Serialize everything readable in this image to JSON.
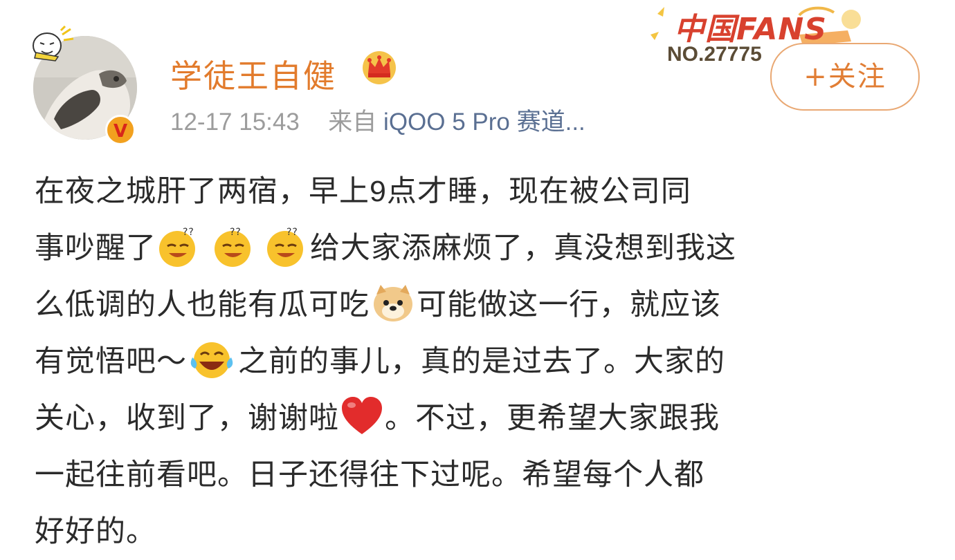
{
  "post": {
    "username": "学徒王自健",
    "timestamp": "12-17 15:43",
    "source_prefix": "来自",
    "source": "iQOO 5 Pro 赛道...",
    "follow_label": "+关注",
    "fans_badge_title": "中国FANS",
    "fans_badge_no": "NO.27775",
    "verified_badge": "V",
    "content": {
      "l1": "在夜之城肝了两宿，早上9点才睡，现在被公司同",
      "l2a": "事吵醒了",
      "l2b": "给大家添麻烦了，真没想到我这",
      "l3a": "么低调的人也能有瓜可吃",
      "l3b": "可能做这一行，就应该",
      "l4a": "有觉悟吧～",
      "l4b": "之前的事儿，真的是过去了。大家的",
      "l5a": "关心，收到了，谢谢啦",
      "l5b": "。不过，更希望大家跟我",
      "l6": "一起往前看吧。日子还得往下过呢。希望每个人都",
      "l7": "好好的。"
    },
    "emojis": [
      "sleepy-face-icon",
      "sleepy-face-icon",
      "sleepy-face-icon",
      "doge-icon",
      "laughing-tears-icon",
      "red-heart-icon"
    ],
    "colors": {
      "username": "#e27b2c",
      "source": "#5a6f92",
      "meta": "#9c9c9c",
      "follow": "#e17e35",
      "text": "#2b2b2b"
    }
  }
}
